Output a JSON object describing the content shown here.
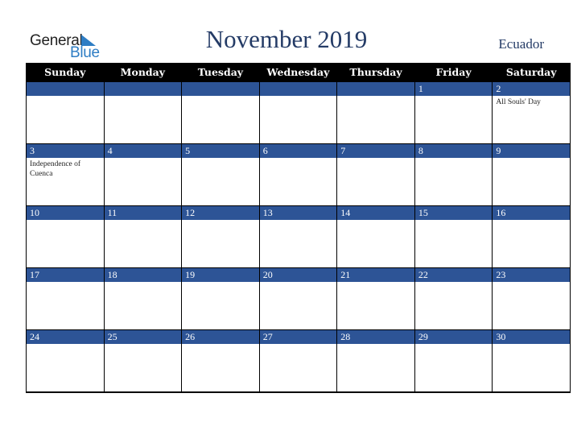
{
  "brand": {
    "word1": "General",
    "word2": "Blue"
  },
  "header": {
    "title": "November 2019",
    "country": "Ecuador"
  },
  "colors": {
    "header_bg": "#000000",
    "band": "#2d5496",
    "title": "#243b66",
    "brand_blue": "#2e7dc4"
  },
  "weekdays": [
    "Sunday",
    "Monday",
    "Tuesday",
    "Wednesday",
    "Thursday",
    "Friday",
    "Saturday"
  ],
  "weeks": [
    [
      {
        "day": "",
        "event": ""
      },
      {
        "day": "",
        "event": ""
      },
      {
        "day": "",
        "event": ""
      },
      {
        "day": "",
        "event": ""
      },
      {
        "day": "",
        "event": ""
      },
      {
        "day": "1",
        "event": ""
      },
      {
        "day": "2",
        "event": "All Souls' Day"
      }
    ],
    [
      {
        "day": "3",
        "event": "Independence of Cuenca"
      },
      {
        "day": "4",
        "event": ""
      },
      {
        "day": "5",
        "event": ""
      },
      {
        "day": "6",
        "event": ""
      },
      {
        "day": "7",
        "event": ""
      },
      {
        "day": "8",
        "event": ""
      },
      {
        "day": "9",
        "event": ""
      }
    ],
    [
      {
        "day": "10",
        "event": ""
      },
      {
        "day": "11",
        "event": ""
      },
      {
        "day": "12",
        "event": ""
      },
      {
        "day": "13",
        "event": ""
      },
      {
        "day": "14",
        "event": ""
      },
      {
        "day": "15",
        "event": ""
      },
      {
        "day": "16",
        "event": ""
      }
    ],
    [
      {
        "day": "17",
        "event": ""
      },
      {
        "day": "18",
        "event": ""
      },
      {
        "day": "19",
        "event": ""
      },
      {
        "day": "20",
        "event": ""
      },
      {
        "day": "21",
        "event": ""
      },
      {
        "day": "22",
        "event": ""
      },
      {
        "day": "23",
        "event": ""
      }
    ],
    [
      {
        "day": "24",
        "event": ""
      },
      {
        "day": "25",
        "event": ""
      },
      {
        "day": "26",
        "event": ""
      },
      {
        "day": "27",
        "event": ""
      },
      {
        "day": "28",
        "event": ""
      },
      {
        "day": "29",
        "event": ""
      },
      {
        "day": "30",
        "event": ""
      }
    ]
  ]
}
